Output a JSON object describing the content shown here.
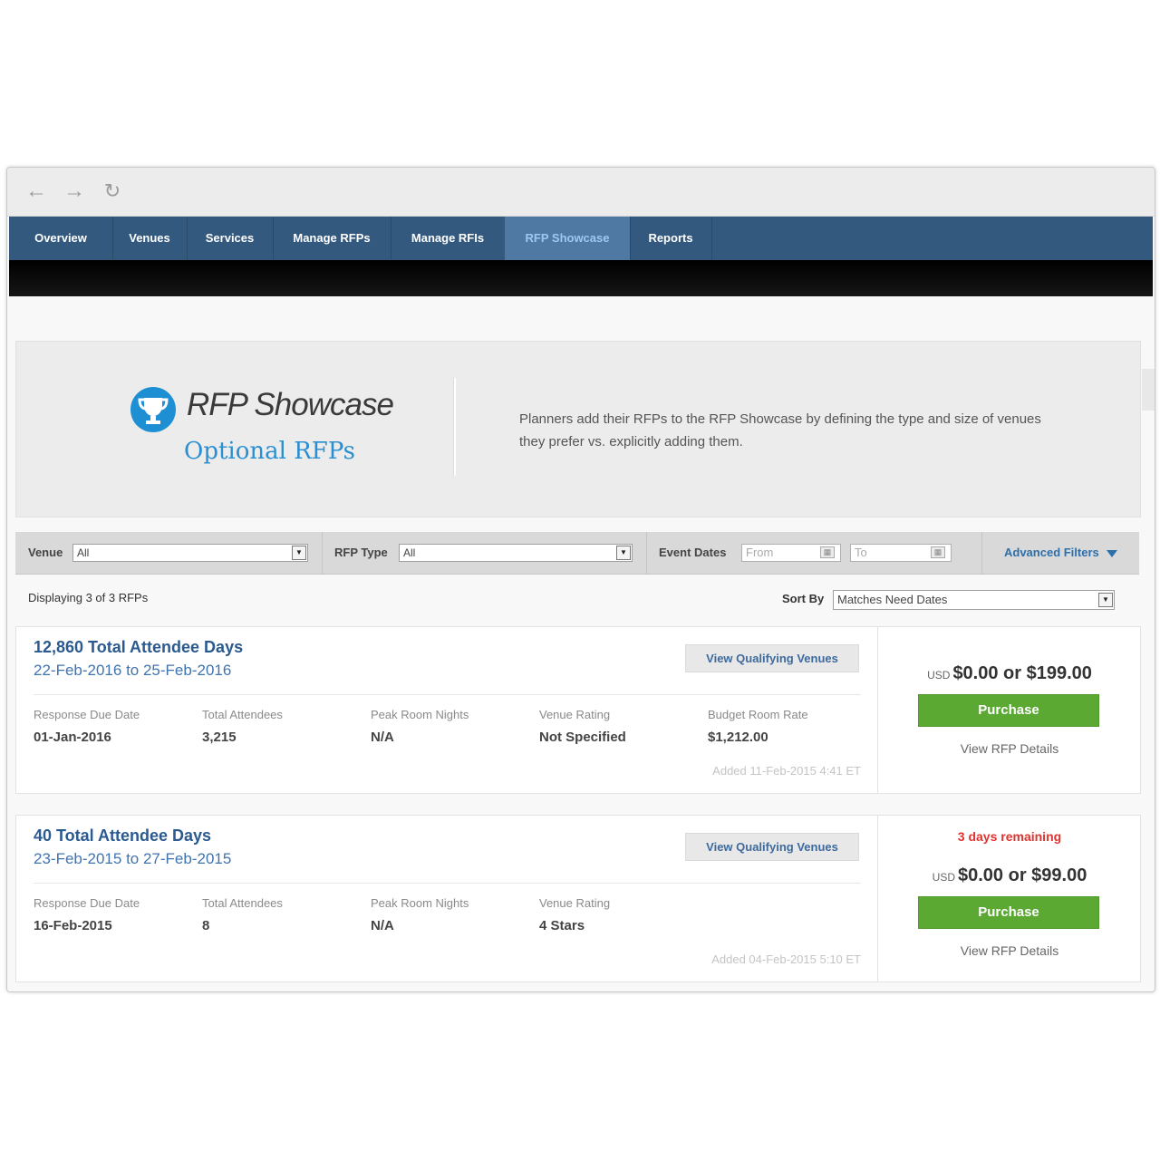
{
  "nav_tabs": [
    "Overview",
    "Venues",
    "Services",
    "Manage RFPs",
    "Manage RFIs",
    "RFP Showcase",
    "Reports"
  ],
  "hero": {
    "title": "RFP Showcase",
    "subtitle": "Optional RFPs",
    "description": "Planners add their RFPs to the RFP Showcase by defining the type and size of venues they prefer vs. explicitly adding them."
  },
  "filters": {
    "venue_label": "Venue",
    "venue_value": "All",
    "rfp_type_label": "RFP Type",
    "rfp_type_value": "All",
    "event_dates_label": "Event Dates",
    "from_placeholder": "From",
    "to_placeholder": "To",
    "advanced_label": "Advanced Filters"
  },
  "results": {
    "display_text": "Displaying 3 of 3 RFPs",
    "sort_label": "Sort By",
    "sort_value": "Matches Need Dates"
  },
  "metric_labels": {
    "response_due": "Response Due Date",
    "total_attendees": "Total Attendees",
    "peak_nights": "Peak Room Nights",
    "venue_rating": "Venue Rating",
    "budget_rate": "Budget Room Rate"
  },
  "cards": [
    {
      "title": "12,860 Total Attendee Days",
      "dates": "22-Feb-2016 to 25-Feb-2016",
      "view_btn": "View Qualifying Venues",
      "response_due": "01-Jan-2016",
      "total_attendees": "3,215",
      "peak_nights": "N/A",
      "venue_rating": "Not Specified",
      "budget_rate": "$1,212.00",
      "added": "Added 11-Feb-2015 4:41 ET",
      "currency": "USD",
      "price": "$0.00 or $199.00",
      "purchase": "Purchase",
      "details": "View RFP Details"
    },
    {
      "title": "40 Total Attendee Days",
      "dates": "23-Feb-2015 to 27-Feb-2015",
      "view_btn": "View Qualifying Venues",
      "response_due": "16-Feb-2015",
      "total_attendees": "8",
      "peak_nights": "N/A",
      "venue_rating": "4 Stars",
      "added": "Added 04-Feb-2015 5:10 ET",
      "remaining": "3 days remaining",
      "currency": "USD",
      "price": "$0.00 or $99.00",
      "purchase": "Purchase",
      "details": "View RFP Details"
    }
  ],
  "icons": [
    "back-arrow-icon",
    "forward-arrow-icon",
    "reload-icon",
    "trophy-icon",
    "calendar-icon",
    "dropdown-arrow-icon"
  ],
  "colors": {
    "nav_bg": "#33597f",
    "nav_active": "#4f79a3",
    "accent_blue": "#2a8fd0",
    "purchase_green": "#5ba833",
    "alert_red": "#e0322e"
  }
}
